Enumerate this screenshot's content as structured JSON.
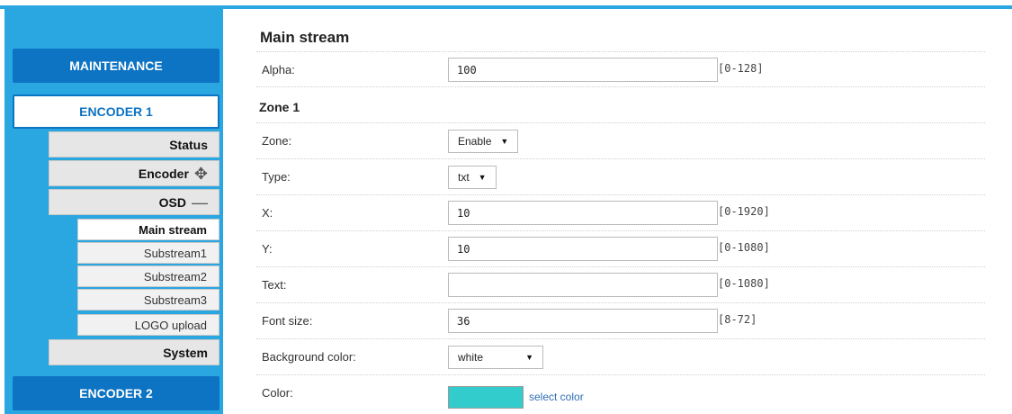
{
  "sidebar": {
    "maintenance": "MAINTENANCE",
    "encoder1": "ENCODER 1",
    "encoder2": "ENCODER 2",
    "subs": {
      "status": "Status",
      "encoder": "Encoder",
      "osd": "OSD",
      "system": "System"
    },
    "leaves": [
      "Main stream",
      "Substream1",
      "Substream2",
      "Substream3",
      "LOGO upload"
    ]
  },
  "main": {
    "title": "Main stream",
    "alpha": {
      "label": "Alpha:",
      "value": "100",
      "range": "[0-128]"
    },
    "zone_title": "Zone 1",
    "zone": {
      "label": "Zone:",
      "value": "Enable"
    },
    "type": {
      "label": "Type:",
      "value": "txt"
    },
    "x": {
      "label": "X:",
      "value": "10",
      "range": "[0-1920]"
    },
    "y": {
      "label": "Y:",
      "value": "10",
      "range": "[0-1080]"
    },
    "text": {
      "label": "Text:",
      "value": "",
      "range": "[0-1080]"
    },
    "font_size": {
      "label": "Font size:",
      "value": "36",
      "range": "[8-72]"
    },
    "bg_color": {
      "label": "Background color:",
      "value": "white"
    },
    "color": {
      "label": "Color:",
      "swatch": "#33cccc",
      "link": "select color"
    }
  },
  "colors": {
    "sidebar": "#2aa7e1",
    "nav_button": "#0d73c3"
  }
}
